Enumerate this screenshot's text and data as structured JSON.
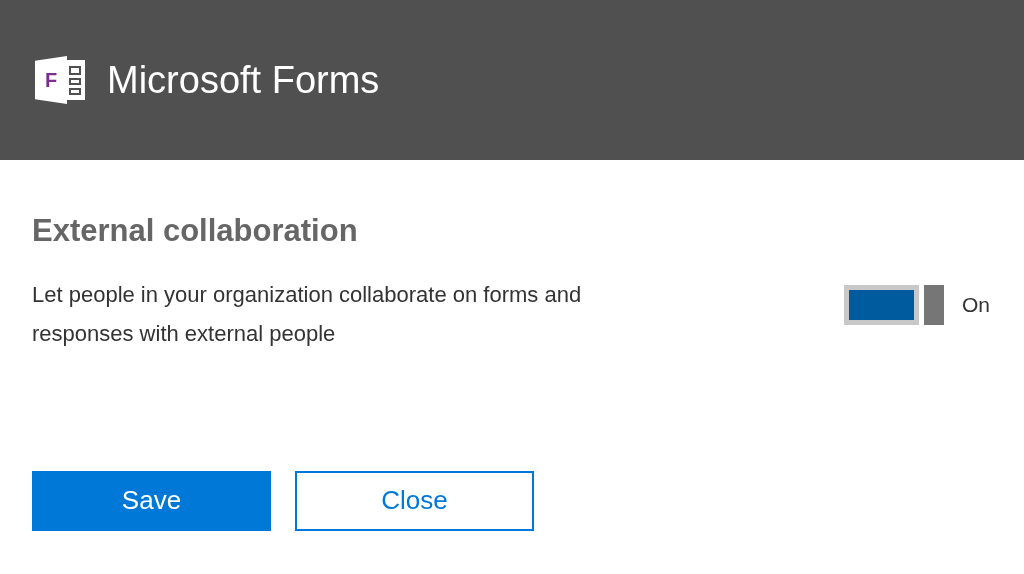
{
  "header": {
    "logo_letter": "F",
    "title": "Microsoft Forms"
  },
  "setting": {
    "title": "External collaboration",
    "description": "Let people in your organization collaborate on forms and responses with external people",
    "toggle": {
      "on": true,
      "label": "On"
    }
  },
  "buttons": [
    {
      "label": "Save",
      "kind": "primary"
    },
    {
      "label": "Close",
      "kind": "secondary"
    }
  ]
}
